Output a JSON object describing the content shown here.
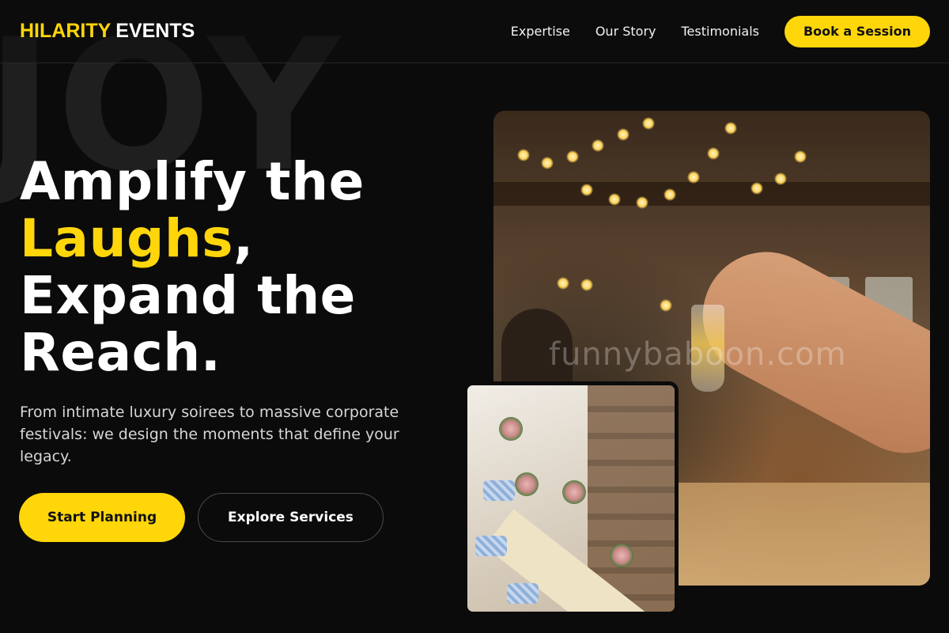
{
  "background_word": "JOY",
  "brand": {
    "highlight": "HILARITY",
    "rest": "EVENTS"
  },
  "nav": {
    "links": [
      "Expertise",
      "Our Story",
      "Testimonials"
    ],
    "cta": "Book a Session"
  },
  "hero": {
    "title_line1": "Amplify the",
    "title_highlight": "Laughs",
    "title_comma": ",",
    "title_line3": "Expand the",
    "title_line4": "Reach.",
    "subtitle": "From intimate luxury soirees to massive corporate festivals: we design the moments that define your legacy.",
    "primary_button": "Start Planning",
    "secondary_button": "Explore Services"
  },
  "images": {
    "main_watermark": "funnybaboon.com"
  },
  "colors": {
    "accent": "#ffd60a",
    "background": "#0b0b0b",
    "text": "#ffffff"
  }
}
